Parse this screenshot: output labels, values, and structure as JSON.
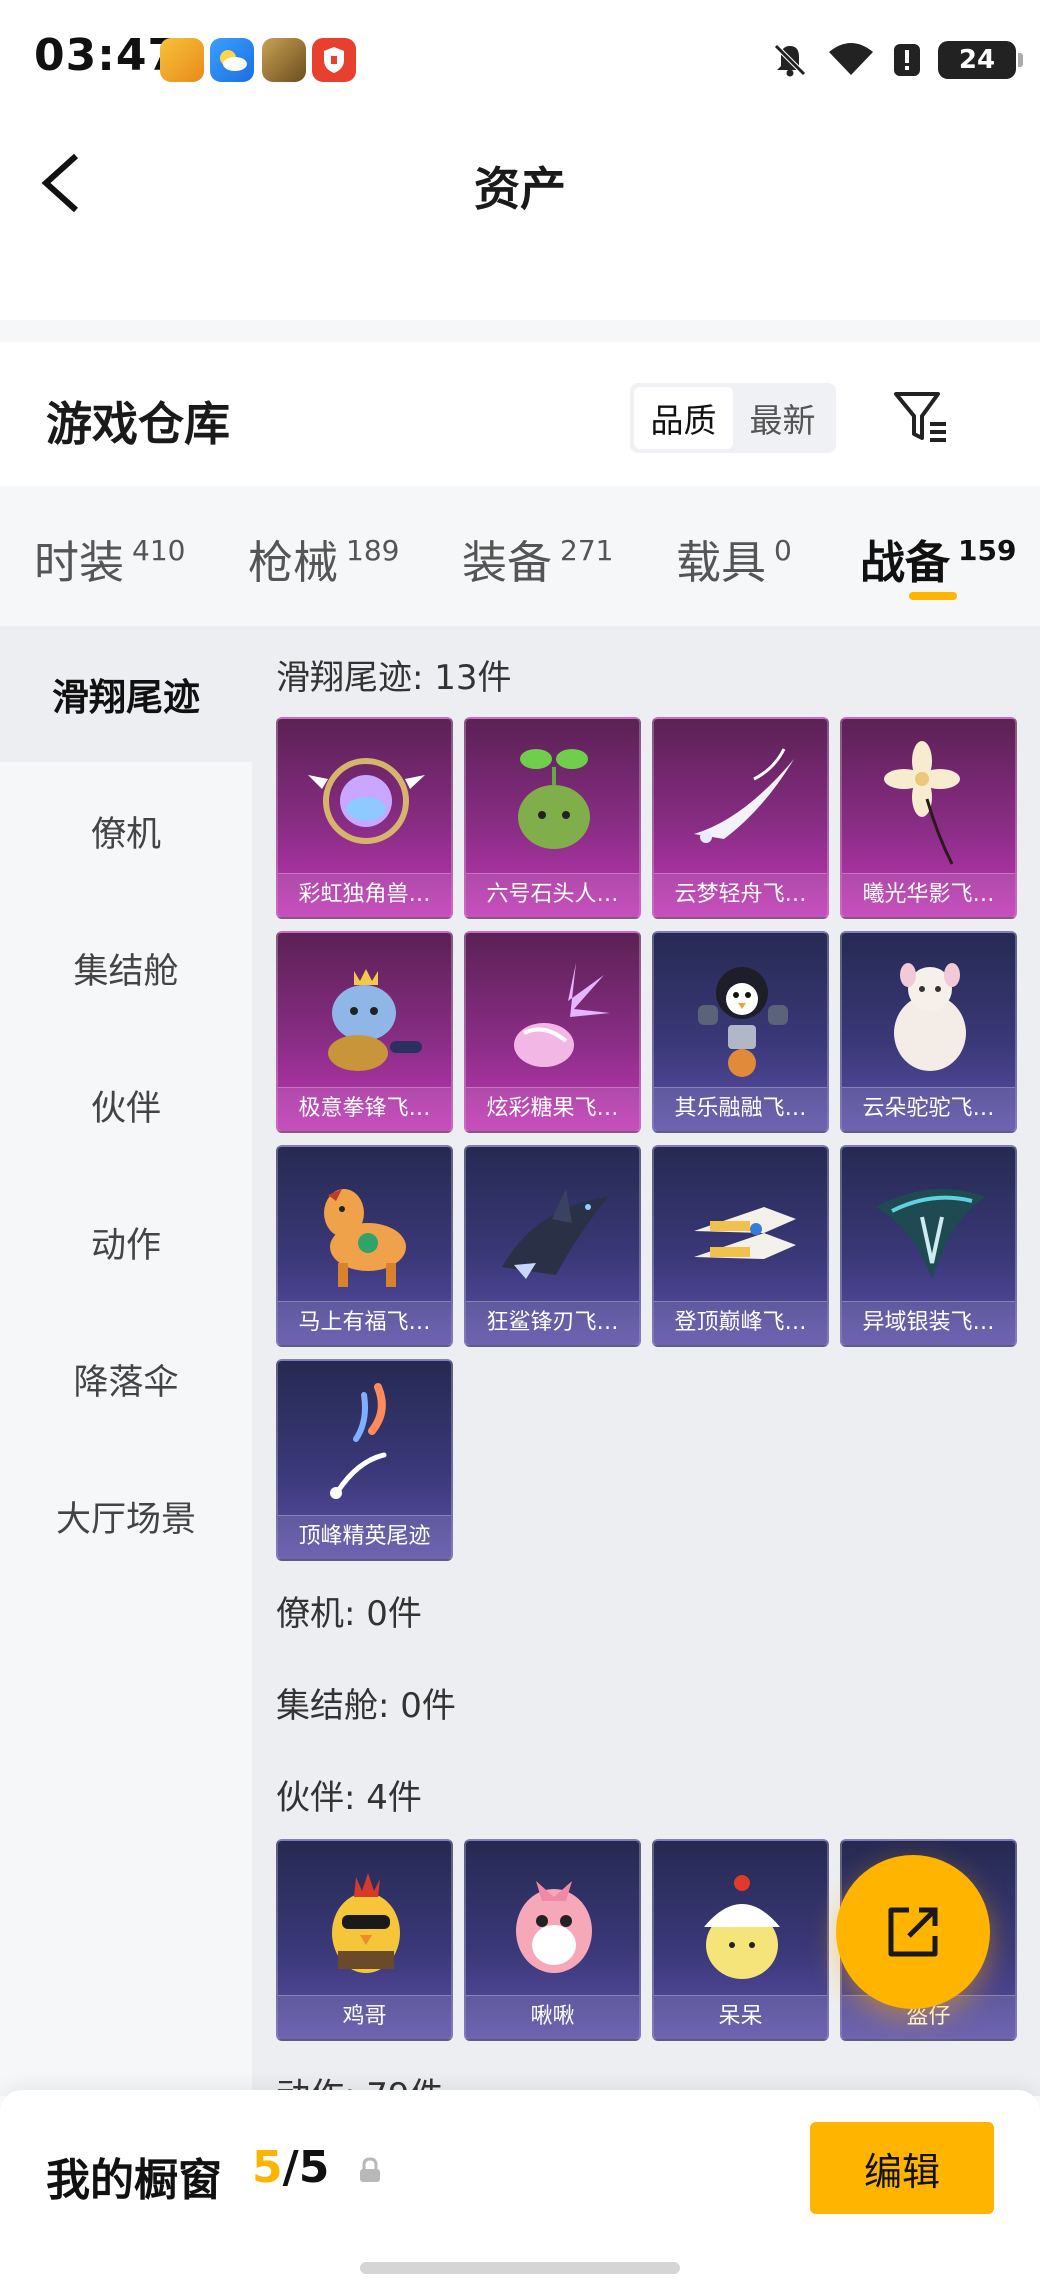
{
  "status_bar": {
    "time": "03:47",
    "battery": "24",
    "icons": [
      "game-app-icon",
      "weather-app-icon",
      "game-app-icon-2",
      "shield-app-icon",
      "bell-muted-icon",
      "wifi-icon",
      "alert-icon",
      "battery-icon"
    ]
  },
  "header": {
    "title": "资产",
    "back_icon": "chevron-left-icon"
  },
  "warehouse": {
    "title": "游戏仓库",
    "sort_options": [
      "品质",
      "最新"
    ],
    "active_sort": "品质",
    "filter_icon": "filter-icon"
  },
  "tabs": [
    {
      "label": "时装",
      "count": "410"
    },
    {
      "label": "枪械",
      "count": "189"
    },
    {
      "label": "装备",
      "count": "271"
    },
    {
      "label": "载具",
      "count": "0"
    },
    {
      "label": "战备",
      "count": "159",
      "active": true
    }
  ],
  "sidebar": {
    "items": [
      "滑翔尾迹",
      "僚机",
      "集结舱",
      "伙伴",
      "动作",
      "降落伞",
      "大厅场景"
    ],
    "active": "滑翔尾迹"
  },
  "sections": [
    {
      "title": "滑翔尾迹: 13件"
    },
    {
      "title": "僚机: 0件"
    },
    {
      "title": "集结舱: 0件"
    },
    {
      "title": "伙伴: 4件"
    },
    {
      "title": "动作: 79件"
    }
  ],
  "glide_items": [
    {
      "label": "彩虹独角兽…",
      "rarity": "pink"
    },
    {
      "label": "六号石头人…",
      "rarity": "pink"
    },
    {
      "label": "云梦轻舟飞…",
      "rarity": "pink"
    },
    {
      "label": "曦光华影飞…",
      "rarity": "pink"
    },
    {
      "label": "极意拳锋飞…",
      "rarity": "pink"
    },
    {
      "label": "炫彩糖果飞…",
      "rarity": "pink"
    },
    {
      "label": "其乐融融飞…",
      "rarity": "blue"
    },
    {
      "label": "云朵驼驼飞…",
      "rarity": "blue"
    },
    {
      "label": "马上有福飞…",
      "rarity": "blue"
    },
    {
      "label": "狂鲨锋刃飞…",
      "rarity": "blue"
    },
    {
      "label": "登顶巅峰飞…",
      "rarity": "blue"
    },
    {
      "label": "异域银装飞…",
      "rarity": "blue"
    },
    {
      "label": "顶峰精英尾迹",
      "rarity": "blue"
    }
  ],
  "partner_items": [
    {
      "label": "鸡哥",
      "rarity": "blue"
    },
    {
      "label": "啾啾",
      "rarity": "blue"
    },
    {
      "label": "呆呆",
      "rarity": "blue"
    },
    {
      "label": "盔仔",
      "rarity": "blue"
    }
  ],
  "fab": {
    "icon": "share-export-icon"
  },
  "showcase": {
    "label": "我的橱窗",
    "count_now": "5",
    "count_sep": "/",
    "count_max": "5",
    "lock_icon": "lock-icon",
    "edit_label": "编辑"
  },
  "colors": {
    "accent": "#ffb400",
    "card_pink": "#a631a0",
    "card_blue": "#3a3878",
    "sidebar_bg": "#f6f7f9",
    "content_bg": "#eceef2"
  }
}
